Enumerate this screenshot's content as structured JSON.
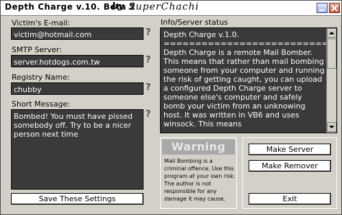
{
  "window": {
    "title": "Depth Charge v.10. Beta 2",
    "title_by": "by",
    "title_author": "SuperChachi"
  },
  "form": {
    "email_label": "Victim's E-mail:",
    "email_value": "victim@hotmail.com",
    "smtp_label": "SMTP Server:",
    "smtp_value": "server.hotdogs.com.tw",
    "registry_label": "Registry Name:",
    "registry_value": "chubby",
    "message_label": "Short Message:",
    "message_value": "Bombed! You must have pissed somebody off. Try to be a nicer person next time",
    "help_glyph": "?"
  },
  "info": {
    "label": "Info/Server status",
    "text": "Depth Charge v.1.0.\n==========================\nDepth Charge is a remote Mail Bomber. This means that rather than mail bombing someone from your computer and running the risk of getting caught, you can upload a configured Depth Charge server to someone else's computer and safely bomb your victim from an unknowing host. It was written in VB6 and uses winsock. This means"
  },
  "warning": {
    "title": "Warning",
    "text": "Mail Bombing is a criminal offence. Use this program at your own risk. The author is not responsible for any damage it may cause."
  },
  "buttons": {
    "save": "Save These Settings",
    "make_server": "Make Server",
    "make_remover": "Make Remover",
    "exit": "Exit"
  },
  "colors": {
    "face": "#d4d0c8",
    "field_bg": "#3a3a3a",
    "field_text": "#ffffff"
  }
}
